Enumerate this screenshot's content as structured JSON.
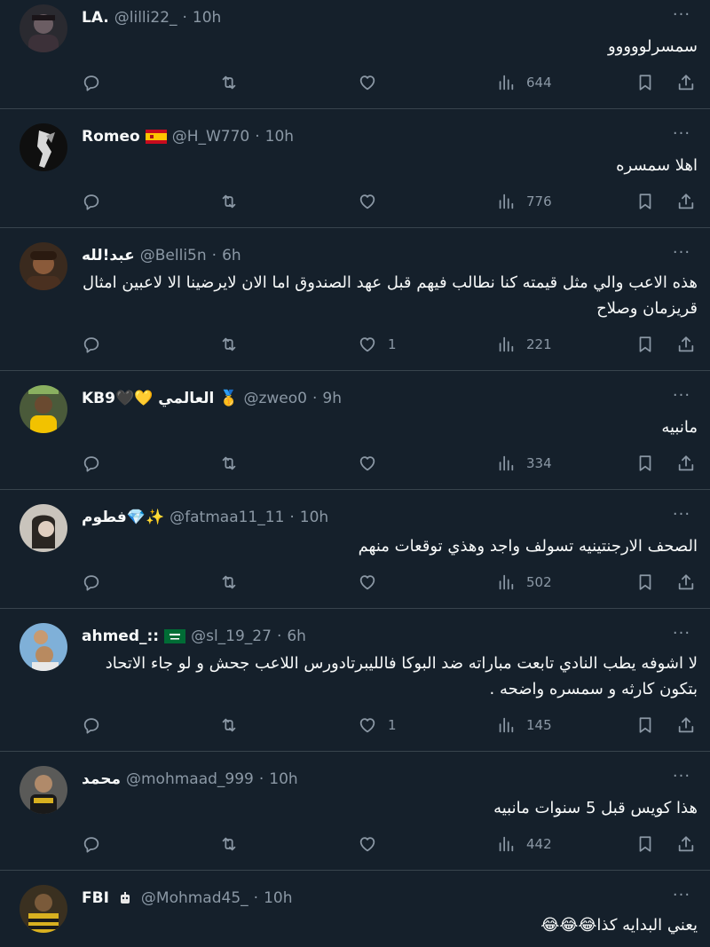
{
  "tweets": [
    {
      "name": "LA.",
      "handle": "@lilli22_",
      "time": "10h",
      "text": "سمسرلووووو",
      "replies": "",
      "retweets": "",
      "likes": "",
      "views": "644",
      "badge": ""
    },
    {
      "name": "Romeo",
      "handle": "@H_W770",
      "time": "10h",
      "text": "اهلا سمسره",
      "replies": "",
      "retweets": "",
      "likes": "",
      "views": "776",
      "badge": "spain-flag"
    },
    {
      "name": "عبد!لله",
      "handle": "@Belli5n",
      "time": "6h",
      "text": "هذه الاعب والي مثل قيمته كنا نطالب فيهم قبل عهد الصندوق اما الان لايرضينا الا لاعبين امثال قريزمان وصلاح",
      "replies": "",
      "retweets": "",
      "likes": "1",
      "views": "221",
      "badge": ""
    },
    {
      "name": "KB9🖤💛 العالمي 🥇",
      "handle": "@zweo0",
      "time": "9h",
      "text": "مانبيه",
      "replies": "",
      "retweets": "",
      "likes": "",
      "views": "334",
      "badge": ""
    },
    {
      "name": "فطوم💎✨",
      "handle": "@fatmaa11_11",
      "time": "10h",
      "text": "الصحف الارجنتينيه تسولف واجد وهذي توقعات منهم",
      "replies": "",
      "retweets": "",
      "likes": "",
      "views": "502",
      "badge": ""
    },
    {
      "name": "ahmed_::",
      "handle": "@sl_19_27",
      "time": "6h",
      "text": "لا اشوفه يطب النادي تابعت مباراته ضد البوكا فالليبرتادورس اللاعب جحش و لو جاء الاتحاد بتكون كارثه و سمسره واضحه .",
      "replies": "",
      "retweets": "",
      "likes": "1",
      "views": "145",
      "badge": "saudi-flag"
    },
    {
      "name": "محمد",
      "handle": "@mohmaad_999",
      "time": "10h",
      "text": "هذا كويس قبل 5 سنوات مانبيه",
      "replies": "",
      "retweets": "",
      "likes": "",
      "views": "442",
      "badge": ""
    },
    {
      "name": "FBI",
      "handle": "@Mohmad45_",
      "time": "10h",
      "text": "يعني البدايه كذا😂😂😂",
      "replies": "",
      "retweets": "",
      "likes": "",
      "views": "",
      "badge": "robot-emoji"
    }
  ],
  "ui": {
    "more_label": "···",
    "dot": "·"
  },
  "colors": {
    "background": "#15202b",
    "divider": "#38444d",
    "muted": "#8b98a5",
    "text": "#f7f9f9"
  }
}
